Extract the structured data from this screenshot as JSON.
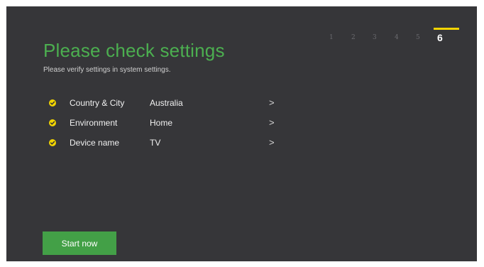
{
  "header": {
    "title": "Please check settings",
    "subtitle": "Please verify settings in system settings."
  },
  "stepper": {
    "steps": [
      "1",
      "2",
      "3",
      "4",
      "5",
      "6"
    ],
    "current": 6,
    "active_color": "#f2d400"
  },
  "settings": {
    "items": [
      {
        "label": "Country & City",
        "value": "Australia",
        "icon": "check-circle-icon",
        "chevron": ">"
      },
      {
        "label": "Environment",
        "value": "Home",
        "icon": "check-circle-icon",
        "chevron": ">"
      },
      {
        "label": "Device name",
        "value": "TV",
        "icon": "check-circle-icon",
        "chevron": ">"
      }
    ]
  },
  "actions": {
    "start_label": "Start now"
  },
  "colors": {
    "background": "#363639",
    "accent": "#4caf50",
    "button": "#43a047",
    "check": "#f2d400"
  }
}
